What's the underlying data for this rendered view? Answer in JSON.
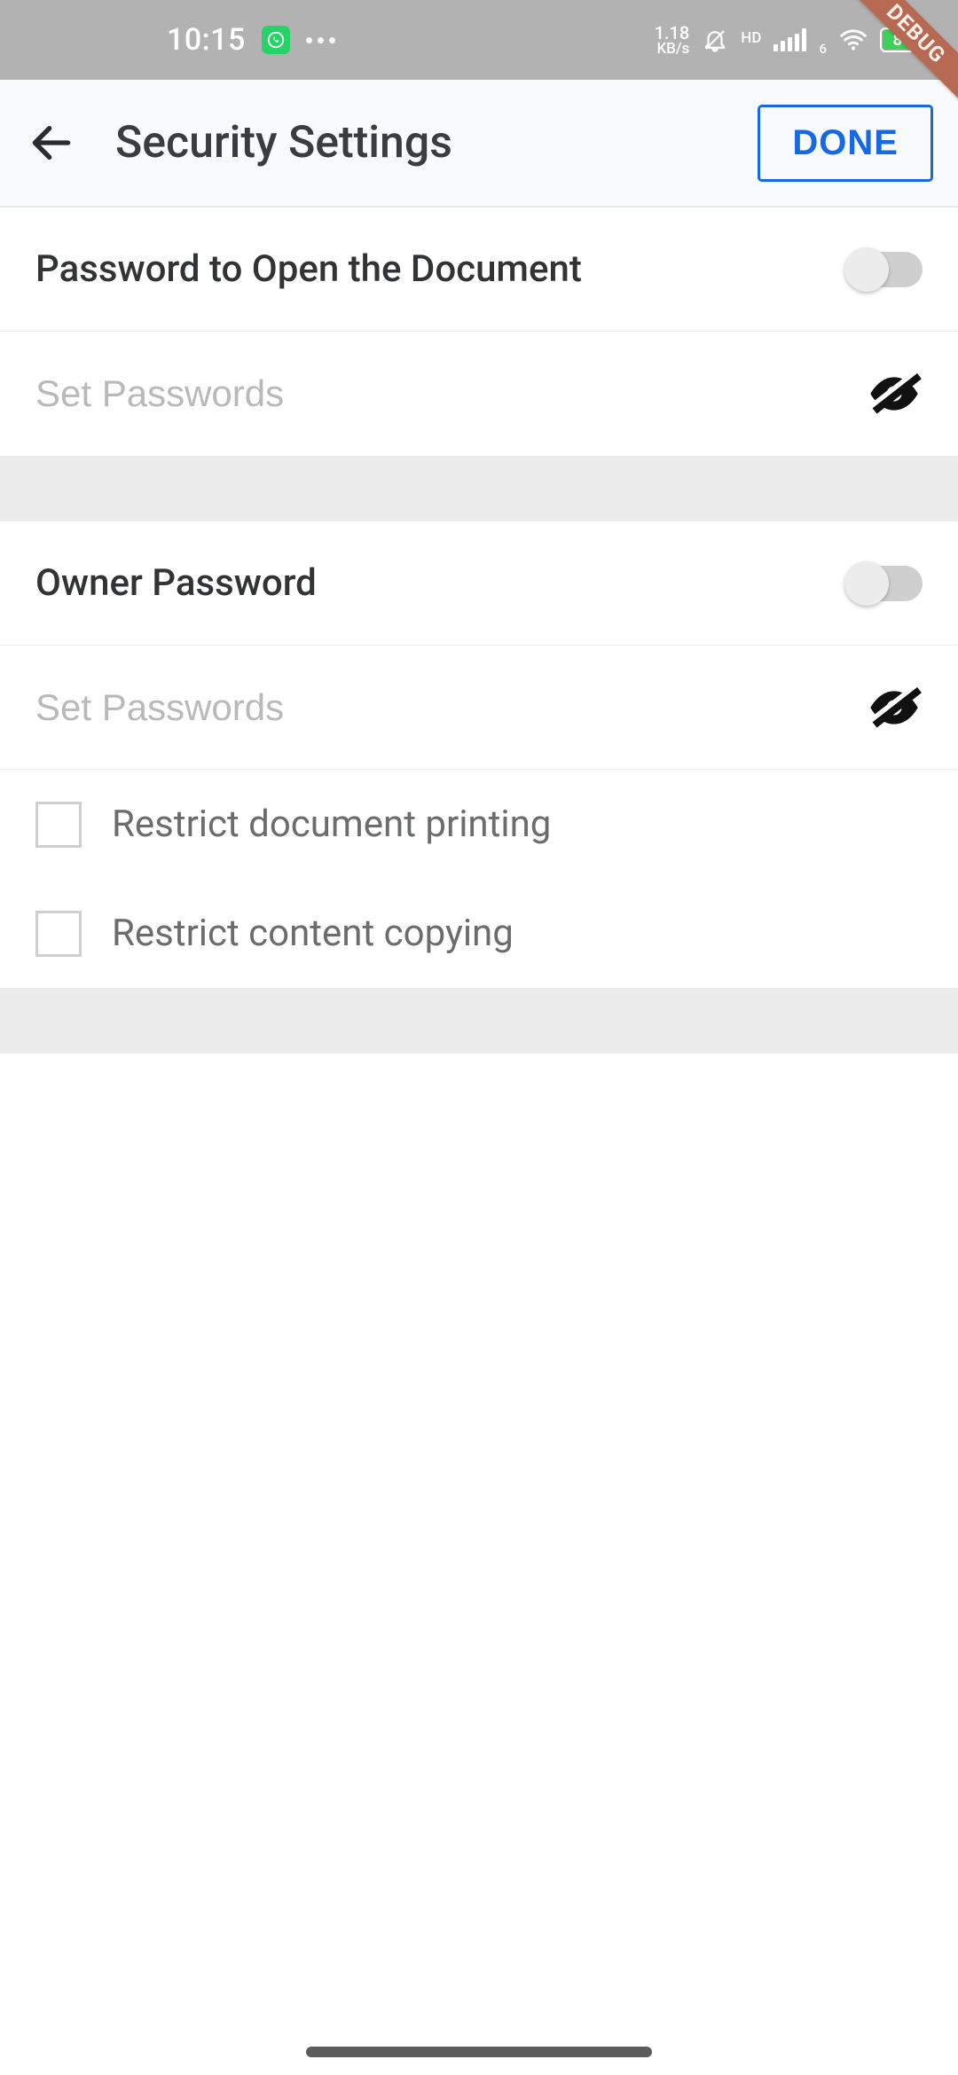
{
  "statusbar": {
    "time": "10:15",
    "kbps_top": "1.18",
    "kbps_bot": "KB/s",
    "hd": "HD",
    "sig_sub": "6",
    "battery_pct": "89",
    "debug": "DEBUG"
  },
  "appbar": {
    "title": "Security Settings",
    "done": "DONE"
  },
  "section_open": {
    "label": "Password to Open the Document",
    "toggle_on": false,
    "password_placeholder": "Set Passwords"
  },
  "section_owner": {
    "label": "Owner Password",
    "toggle_on": false,
    "password_placeholder": "Set Passwords",
    "restrict_print": {
      "checked": false,
      "label": "Restrict document printing"
    },
    "restrict_copy": {
      "checked": false,
      "label": "Restrict content copying"
    }
  }
}
